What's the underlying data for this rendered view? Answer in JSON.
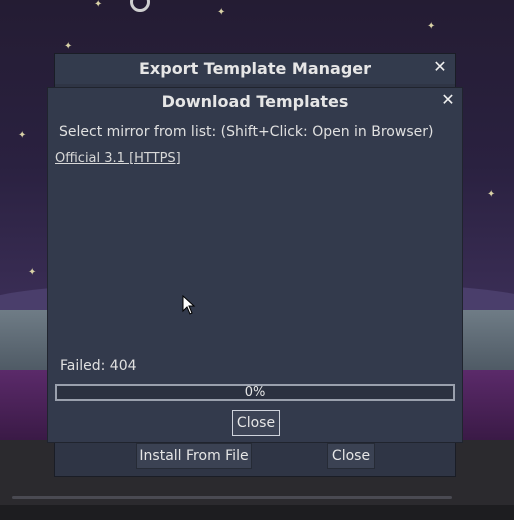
{
  "back_window": {
    "title": "Export Template Manager",
    "close_glyph": "✕",
    "buttons": {
      "install_from_file": "Install From File",
      "close": "Close"
    }
  },
  "dialog": {
    "title": "Download Templates",
    "close_glyph": "✕",
    "message": "Select mirror from list: (Shift+Click: Open in Browser)",
    "mirrors": [
      "Official 3.1 [HTTPS]"
    ],
    "status": "Failed: 404",
    "progress": {
      "fraction": 0,
      "label": "0%"
    },
    "close_button": "Close"
  },
  "colors": {
    "dialog_bg": "#333a4c",
    "window_bg": "#2f3545",
    "progress_border": "#9aa0ad"
  },
  "icons": {
    "close": "close-icon",
    "cursor": "mouse-pointer-icon"
  }
}
